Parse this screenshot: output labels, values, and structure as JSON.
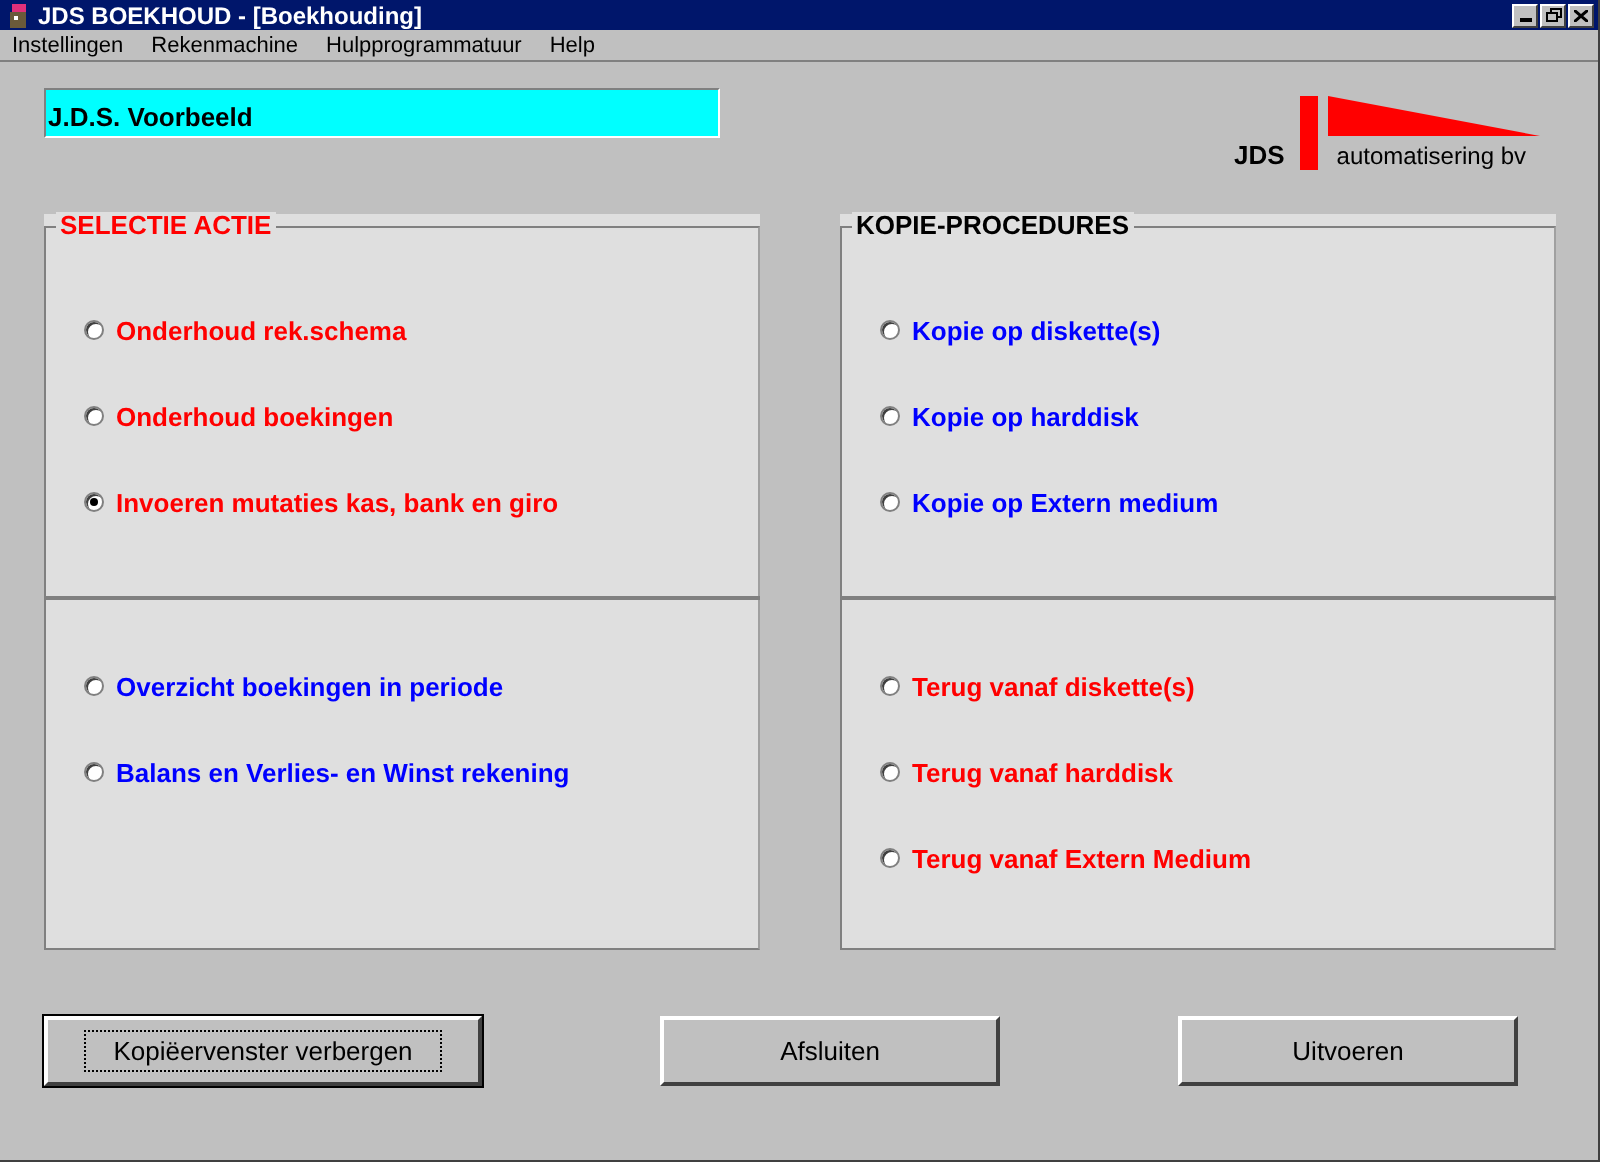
{
  "window": {
    "title": "JDS BOEKHOUD - [Boekhouding]"
  },
  "menu": [
    "Instellingen",
    "Rekenmachine",
    "Hulpprogrammatuur",
    "Help"
  ],
  "company_field": {
    "value": "J.D.S. Voorbeeld"
  },
  "logo": {
    "brand": "JDS",
    "tagline": "automatisering bv"
  },
  "panels": [
    {
      "title": "SELECTIE ACTIE",
      "color": "#ff0000",
      "sections": [
        [
          {
            "label": "Onderhoud rek.schema",
            "selected": false,
            "color": "#ff0000"
          },
          {
            "label": "Onderhoud boekingen",
            "selected": false,
            "color": "#ff0000"
          },
          {
            "label": "Invoeren mutaties kas, bank en giro",
            "selected": true,
            "color": "#ff0000"
          }
        ],
        [
          {
            "label": "Overzicht boekingen in periode",
            "selected": false,
            "color": "#0000ff"
          },
          {
            "label": "Balans en Verlies- en Winst rekening",
            "selected": false,
            "color": "#0000ff"
          }
        ]
      ]
    },
    {
      "title": "KOPIE-PROCEDURES",
      "color": "#000000",
      "sections": [
        [
          {
            "label": "Kopie op diskette(s)",
            "selected": false,
            "color": "#0000ff"
          },
          {
            "label": "Kopie op harddisk",
            "selected": false,
            "color": "#0000ff"
          },
          {
            "label": "Kopie op Extern medium",
            "selected": false,
            "color": "#0000ff"
          }
        ],
        [
          {
            "label": "Terug vanaf diskette(s)",
            "selected": false,
            "color": "#ff0000"
          },
          {
            "label": "Terug vanaf harddisk",
            "selected": false,
            "color": "#ff0000"
          },
          {
            "label": "Terug vanaf Extern Medium",
            "selected": false,
            "color": "#ff0000"
          }
        ]
      ]
    }
  ],
  "buttons": [
    {
      "label": "Kopiëervenster verbergen",
      "default": true
    },
    {
      "label": "Afsluiten",
      "default": false
    },
    {
      "label": "Uitvoeren",
      "default": false
    }
  ]
}
